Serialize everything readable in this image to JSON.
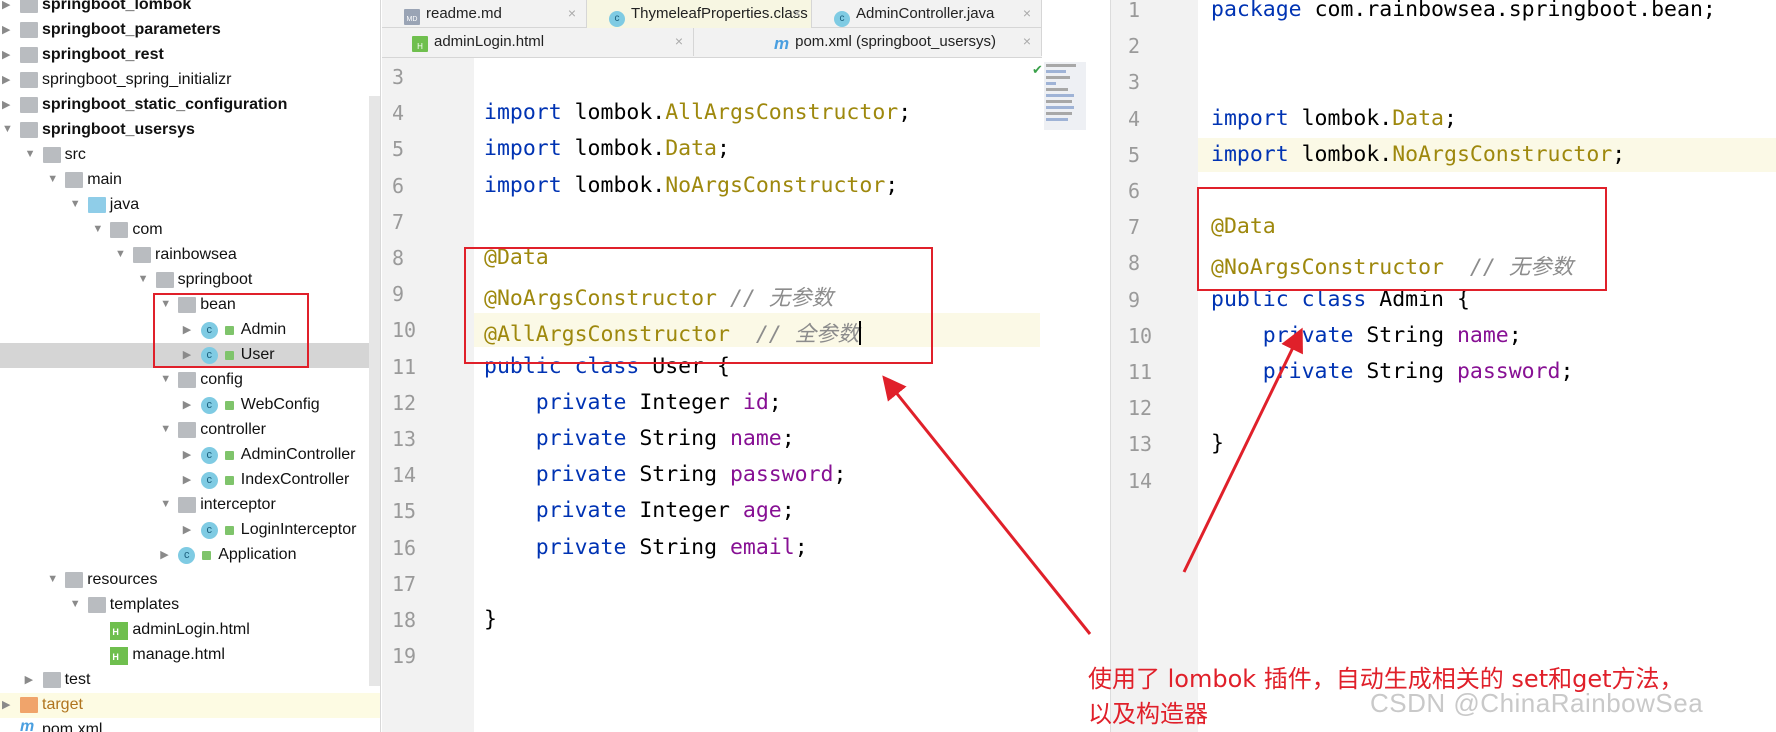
{
  "project_tree": {
    "items": [
      {
        "label": "springboot_lombok",
        "level": 0,
        "arrow": "right",
        "icon": "module-folder-icon",
        "bold": true
      },
      {
        "label": "springboot_parameters",
        "level": 0,
        "arrow": "right",
        "icon": "module-folder-icon",
        "bold": true
      },
      {
        "label": "springboot_rest",
        "level": 0,
        "arrow": "right",
        "icon": "module-folder-icon",
        "bold": true
      },
      {
        "label": "springboot_spring_initializr",
        "level": 0,
        "arrow": "right",
        "icon": "folder-icon",
        "bold": false
      },
      {
        "label": "springboot_static_configuration",
        "level": 0,
        "arrow": "right",
        "icon": "module-folder-icon",
        "bold": true
      },
      {
        "label": "springboot_usersys",
        "level": 0,
        "arrow": "down",
        "icon": "module-folder-icon",
        "bold": true
      },
      {
        "label": "src",
        "level": 1,
        "arrow": "down",
        "icon": "folder-icon"
      },
      {
        "label": "main",
        "level": 2,
        "arrow": "down",
        "icon": "folder-icon"
      },
      {
        "label": "java",
        "level": 3,
        "arrow": "down",
        "icon": "source-folder-icon"
      },
      {
        "label": "com",
        "level": 4,
        "arrow": "down",
        "icon": "package-icon"
      },
      {
        "label": "rainbowsea",
        "level": 5,
        "arrow": "down",
        "icon": "package-icon"
      },
      {
        "label": "springboot",
        "level": 6,
        "arrow": "down",
        "icon": "package-icon"
      },
      {
        "label": "bean",
        "level": 7,
        "arrow": "down",
        "icon": "package-icon"
      },
      {
        "label": "Admin",
        "level": 8,
        "arrow": "right",
        "icon": "class-icon"
      },
      {
        "label": "User",
        "level": 8,
        "arrow": "right",
        "icon": "class-icon",
        "selected": true
      },
      {
        "label": "config",
        "level": 7,
        "arrow": "down",
        "icon": "package-icon"
      },
      {
        "label": "WebConfig",
        "level": 8,
        "arrow": "right",
        "icon": "class-icon"
      },
      {
        "label": "controller",
        "level": 7,
        "arrow": "down",
        "icon": "package-icon"
      },
      {
        "label": "AdminController",
        "level": 8,
        "arrow": "right",
        "icon": "class-icon"
      },
      {
        "label": "IndexController",
        "level": 8,
        "arrow": "right",
        "icon": "class-icon"
      },
      {
        "label": "interceptor",
        "level": 7,
        "arrow": "down",
        "icon": "package-icon"
      },
      {
        "label": "LoginInterceptor",
        "level": 8,
        "arrow": "right",
        "icon": "class-icon"
      },
      {
        "label": "Application",
        "level": 7,
        "arrow": "right",
        "icon": "spring-app-class-icon"
      },
      {
        "label": "resources",
        "level": 2,
        "arrow": "down",
        "icon": "resources-folder-icon"
      },
      {
        "label": "templates",
        "level": 3,
        "arrow": "down",
        "icon": "folder-icon"
      },
      {
        "label": "adminLogin.html",
        "level": 4,
        "arrow": "none",
        "icon": "html-file-icon"
      },
      {
        "label": "manage.html",
        "level": 4,
        "arrow": "none",
        "icon": "html-file-icon"
      },
      {
        "label": "test",
        "level": 1,
        "arrow": "right",
        "icon": "folder-icon"
      },
      {
        "label": "target",
        "level": 0,
        "arrow": "right",
        "icon": "excluded-folder-icon",
        "target": true
      },
      {
        "label": "pom.xml",
        "level": 0,
        "arrow": "none",
        "icon": "maven-icon"
      }
    ]
  },
  "editor_tabs": {
    "row1": [
      {
        "label": "readme.md",
        "icon": "markdown-file-icon",
        "glyph": "MD"
      },
      {
        "label": "ThymeleafProperties.class",
        "icon": "class-icon",
        "glyph": "c",
        "active": true
      },
      {
        "label": "AdminController.java",
        "icon": "class-icon",
        "glyph": "c"
      }
    ],
    "row2": [
      {
        "label": "adminLogin.html",
        "icon": "html-file-icon",
        "glyph": "H"
      },
      {
        "label": "pom.xml (springboot_usersys)",
        "icon": "maven-icon",
        "glyph": "m"
      }
    ],
    "close_glyph": "×"
  },
  "left_editor": {
    "first_line": 3,
    "highlighted_line": 10,
    "lines": [
      [],
      [
        [
          "import ",
          "k"
        ],
        [
          "lombok.",
          ""
        ],
        [
          "AllArgsConstructor",
          "t"
        ],
        [
          ";",
          ""
        ]
      ],
      [
        [
          "import ",
          "k"
        ],
        [
          "lombok.",
          ""
        ],
        [
          "Data",
          "t"
        ],
        [
          ";",
          ""
        ]
      ],
      [
        [
          "import ",
          "k"
        ],
        [
          "lombok.",
          ""
        ],
        [
          "NoArgsConstructor",
          "t"
        ],
        [
          ";",
          ""
        ]
      ],
      [],
      [
        [
          "@Data",
          "t"
        ]
      ],
      [
        [
          "@NoArgsConstructor",
          "t"
        ],
        [
          " // 无参数",
          "c"
        ]
      ],
      [
        [
          "@AllArgsConstructor",
          "t"
        ],
        [
          "  // 全参数",
          "c"
        ]
      ],
      [
        [
          "public class ",
          "k"
        ],
        [
          "User {",
          ""
        ]
      ],
      [
        [
          "    private ",
          "k"
        ],
        [
          "Integer ",
          ""
        ],
        [
          "id",
          "f"
        ],
        [
          ";",
          ""
        ]
      ],
      [
        [
          "    private ",
          "k"
        ],
        [
          "String ",
          ""
        ],
        [
          "name",
          "f"
        ],
        [
          ";",
          ""
        ]
      ],
      [
        [
          "    private ",
          "k"
        ],
        [
          "String ",
          ""
        ],
        [
          "password",
          "f"
        ],
        [
          ";",
          ""
        ]
      ],
      [
        [
          "    private ",
          "k"
        ],
        [
          "Integer ",
          ""
        ],
        [
          "age",
          "f"
        ],
        [
          ";",
          ""
        ]
      ],
      [
        [
          "    private ",
          "k"
        ],
        [
          "String ",
          ""
        ],
        [
          "email",
          "f"
        ],
        [
          ";",
          ""
        ]
      ],
      [],
      [
        [
          "}",
          ""
        ]
      ],
      []
    ]
  },
  "right_editor": {
    "first_line": 1,
    "highlighted_line": 5,
    "lines": [
      [
        [
          "package ",
          "k"
        ],
        [
          "com.rainbowsea.springboot.bean;",
          ""
        ]
      ],
      [],
      [],
      [
        [
          "import ",
          "k"
        ],
        [
          "lombok.",
          ""
        ],
        [
          "Data",
          "t"
        ],
        [
          ";",
          ""
        ]
      ],
      [
        [
          "import ",
          "k"
        ],
        [
          "lombok.",
          ""
        ],
        [
          "NoArgsConstructor",
          "t"
        ],
        [
          ";",
          ""
        ]
      ],
      [],
      [
        [
          "@Data",
          "t"
        ]
      ],
      [
        [
          "@NoArgsConstructor",
          "t"
        ],
        [
          "  // 无参数",
          "c"
        ]
      ],
      [
        [
          "public class ",
          "k"
        ],
        [
          "Admin {",
          ""
        ]
      ],
      [
        [
          "    private ",
          "k"
        ],
        [
          "String ",
          ""
        ],
        [
          "name",
          "f"
        ],
        [
          ";",
          ""
        ]
      ],
      [
        [
          "    private ",
          "k"
        ],
        [
          "String ",
          ""
        ],
        [
          "password",
          "f"
        ],
        [
          ";",
          ""
        ]
      ],
      [],
      [
        [
          "}",
          ""
        ]
      ],
      []
    ]
  },
  "annotation": {
    "line1": "使用了 lombok 插件，自动生成相关的 set和get方法，",
    "line2": "以及构造器",
    "color": "#e0202a"
  },
  "watermark": "CSDN @ChinaRainbowSea"
}
